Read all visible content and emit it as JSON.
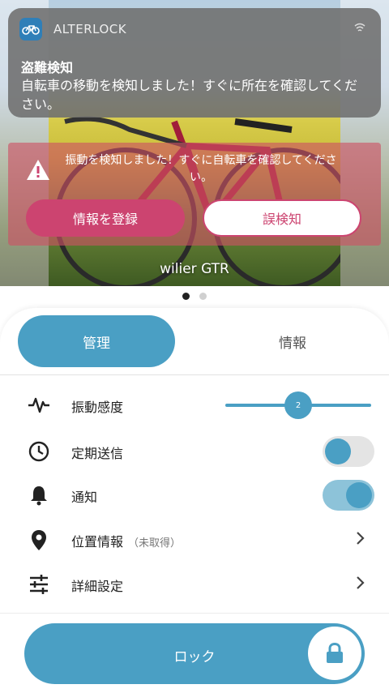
{
  "notification": {
    "app_name": "ALTERLOCK",
    "title": "盗難検知",
    "body": "自転車の移動を検知しました！すぐに所在を確認してください。"
  },
  "alert": {
    "message": "振動を検知しました！すぐに自転車を確認してください。",
    "register_button": "情報を登録",
    "false_detection_button": "誤検知"
  },
  "bike": {
    "name": "wilier GTR"
  },
  "pager": {
    "count": 2,
    "active": 0
  },
  "tabs": [
    {
      "label": "管理",
      "active": true
    },
    {
      "label": "情報",
      "active": false
    }
  ],
  "settings": {
    "vibration": {
      "label": "振動感度",
      "level": 2,
      "slider_fraction": 0.5
    },
    "periodic": {
      "label": "定期送信",
      "enabled": false
    },
    "notification": {
      "label": "通知",
      "enabled": true
    },
    "location": {
      "label": "位置情報",
      "status": "（未取得）"
    },
    "detail": {
      "label": "詳細設定"
    }
  },
  "lock": {
    "label": "ロック"
  },
  "colors": {
    "accent": "#4a9fc4",
    "alert": "#cc4470"
  }
}
